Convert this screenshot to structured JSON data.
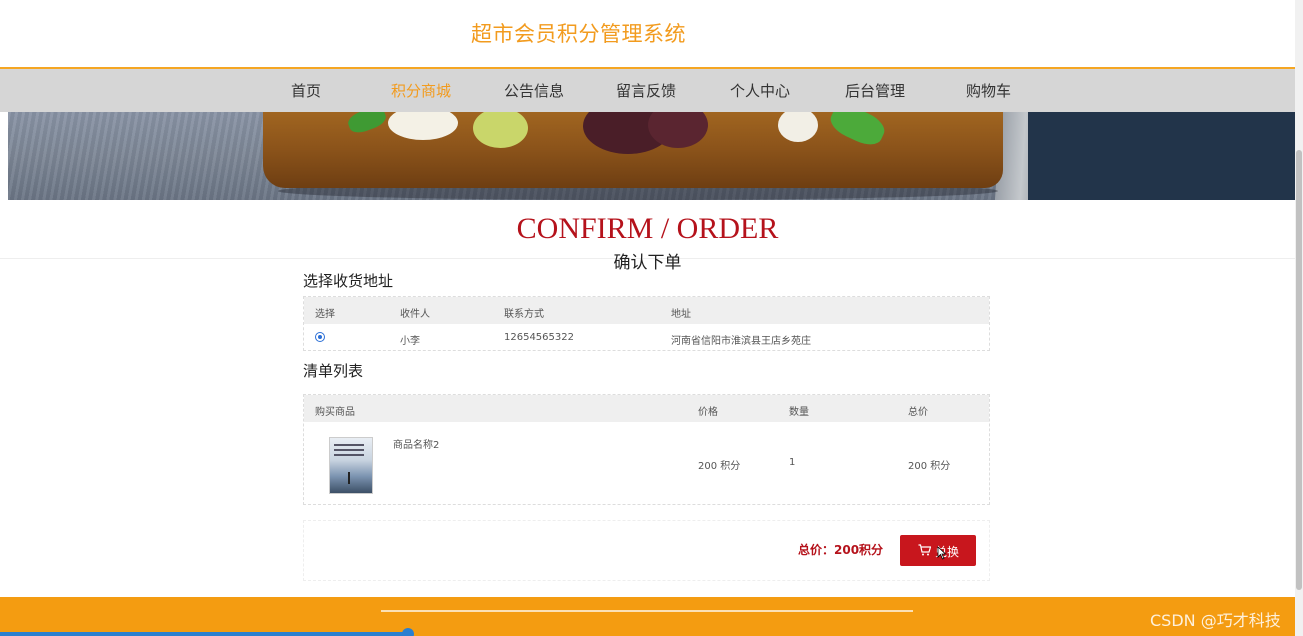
{
  "site": {
    "title": "超市会员积分管理系统"
  },
  "nav": {
    "items": [
      {
        "label": "首页",
        "active": false
      },
      {
        "label": "积分商城",
        "active": true
      },
      {
        "label": "公告信息",
        "active": false
      },
      {
        "label": "留言反馈",
        "active": false
      },
      {
        "label": "个人中心",
        "active": false
      },
      {
        "label": "后台管理",
        "active": false
      },
      {
        "label": "购物车",
        "active": false
      }
    ]
  },
  "heading": {
    "en": "CONFIRM / ORDER",
    "cn": "确认下单"
  },
  "address": {
    "section_title": "选择收货地址",
    "headers": [
      "选择",
      "收件人",
      "联系方式",
      "地址"
    ],
    "rows": [
      {
        "selected": true,
        "recipient": "小李",
        "phone": "12654565322",
        "address": "河南省信阳市淮滨县王店乡苑庄"
      }
    ]
  },
  "order": {
    "section_title": "清单列表",
    "headers": [
      "购买商品",
      "价格",
      "数量",
      "总价"
    ],
    "items": [
      {
        "name": "商品名称2",
        "price": "200 积分",
        "quantity": "1",
        "total": "200 积分"
      }
    ]
  },
  "summary": {
    "total_label": "总价：200积分",
    "redeem_label": "兑换"
  },
  "footer": {
    "watermark": "CSDN @巧才科技"
  },
  "colors": {
    "accent": "#f29b1e",
    "brand_red": "#b5121b",
    "button_red": "#c8161d",
    "footer_orange": "#f49c11",
    "nav_bg": "#d6d6d6"
  }
}
